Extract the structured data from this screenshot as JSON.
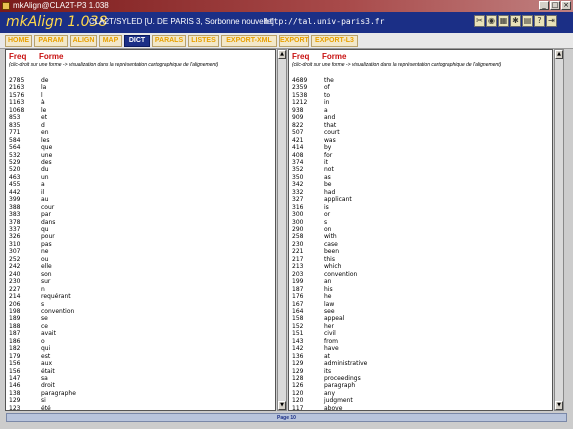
{
  "window": {
    "title": "mkAlign@CLA2T-P3 1.038",
    "controls": [
      "_",
      "□",
      "×"
    ]
  },
  "header": {
    "app_title": "mkAlign 1.038",
    "project": "CLA2T/SYLED [U. DE PARIS 3, Sorbonne nouvelle]",
    "url": "http://tal.univ-paris3.fr",
    "tool_icons": [
      "scissors-icon",
      "globe-icon",
      "grid-icon",
      "gear-icon",
      "book-icon",
      "help-icon",
      "exit-icon"
    ],
    "tool_glyphs": [
      "✂",
      "◉",
      "▦",
      "✱",
      "▤",
      "?",
      "⇥"
    ]
  },
  "menu": {
    "tabs": [
      "HOME",
      "PARAM",
      "ALIGN",
      "MAP",
      "DICT",
      "PARALS",
      "LISTES",
      "EXPORT-XML",
      "EXPORT",
      "EXPORT-L3"
    ],
    "active": "DICT"
  },
  "left": {
    "col_freq": "Freq",
    "col_forme": "Forme",
    "instruction": "(clic-droit sur une forme -> visualization dans la représentation cartographique de l'alignement)",
    "rows": [
      [
        "2785",
        "de"
      ],
      [
        "2163",
        "la"
      ],
      [
        "1576",
        "l"
      ],
      [
        "1163",
        "à"
      ],
      [
        "1068",
        "le"
      ],
      [
        "853",
        "et"
      ],
      [
        "835",
        "d"
      ],
      [
        "771",
        "en"
      ],
      [
        "584",
        "les"
      ],
      [
        "564",
        "que"
      ],
      [
        "532",
        "une"
      ],
      [
        "529",
        "des"
      ],
      [
        "520",
        "du"
      ],
      [
        "463",
        "un"
      ],
      [
        "455",
        "a"
      ],
      [
        "442",
        "il"
      ],
      [
        "399",
        "au"
      ],
      [
        "388",
        "cour"
      ],
      [
        "383",
        "par"
      ],
      [
        "378",
        "dans"
      ],
      [
        "337",
        "qu"
      ],
      [
        "326",
        "pour"
      ],
      [
        "310",
        "pas"
      ],
      [
        "307",
        "ne"
      ],
      [
        "252",
        "ou"
      ],
      [
        "242",
        "elle"
      ],
      [
        "240",
        "son"
      ],
      [
        "230",
        "sur"
      ],
      [
        "227",
        "n"
      ],
      [
        "214",
        "requérant"
      ],
      [
        "206",
        "s"
      ],
      [
        "198",
        "convention"
      ],
      [
        "189",
        "se"
      ],
      [
        "188",
        "ce"
      ],
      [
        "187",
        "avait"
      ],
      [
        "186",
        "o"
      ],
      [
        "182",
        "qui"
      ],
      [
        "179",
        "est"
      ],
      [
        "156",
        "aux"
      ],
      [
        "156",
        "était"
      ],
      [
        "147",
        "sa"
      ],
      [
        "146",
        "droit"
      ],
      [
        "138",
        "paragraphe"
      ],
      [
        "129",
        "si"
      ],
      [
        "123",
        "été"
      ]
    ]
  },
  "right": {
    "col_freq": "Freq",
    "col_forme": "Forme",
    "instruction": "(clic-droit sur une forme -> visualization dans la représentation cartographique de l'alignement)",
    "rows": [
      [
        "4689",
        "the"
      ],
      [
        "2359",
        "of"
      ],
      [
        "1538",
        "to"
      ],
      [
        "1212",
        "in"
      ],
      [
        "938",
        "a"
      ],
      [
        "909",
        "and"
      ],
      [
        "822",
        "that"
      ],
      [
        "507",
        "court"
      ],
      [
        "421",
        "was"
      ],
      [
        "414",
        "by"
      ],
      [
        "408",
        "for"
      ],
      [
        "374",
        "it"
      ],
      [
        "352",
        "not"
      ],
      [
        "350",
        "as"
      ],
      [
        "342",
        "be"
      ],
      [
        "332",
        "had"
      ],
      [
        "327",
        "applicant"
      ],
      [
        "316",
        "is"
      ],
      [
        "300",
        "or"
      ],
      [
        "300",
        "s"
      ],
      [
        "290",
        "on"
      ],
      [
        "258",
        "with"
      ],
      [
        "230",
        "case"
      ],
      [
        "221",
        "been"
      ],
      [
        "217",
        "this"
      ],
      [
        "213",
        "which"
      ],
      [
        "203",
        "convention"
      ],
      [
        "199",
        "an"
      ],
      [
        "187",
        "his"
      ],
      [
        "176",
        "he"
      ],
      [
        "167",
        "law"
      ],
      [
        "164",
        "see"
      ],
      [
        "158",
        "appeal"
      ],
      [
        "152",
        "her"
      ],
      [
        "151",
        "civil"
      ],
      [
        "143",
        "from"
      ],
      [
        "142",
        "have"
      ],
      [
        "136",
        "at"
      ],
      [
        "129",
        "administrative"
      ],
      [
        "129",
        "its"
      ],
      [
        "128",
        "proceedings"
      ],
      [
        "126",
        "paragraph"
      ],
      [
        "120",
        "any"
      ],
      [
        "120",
        "judgment"
      ],
      [
        "117",
        "above"
      ]
    ]
  },
  "footer": {
    "page_label": "Page 10"
  }
}
